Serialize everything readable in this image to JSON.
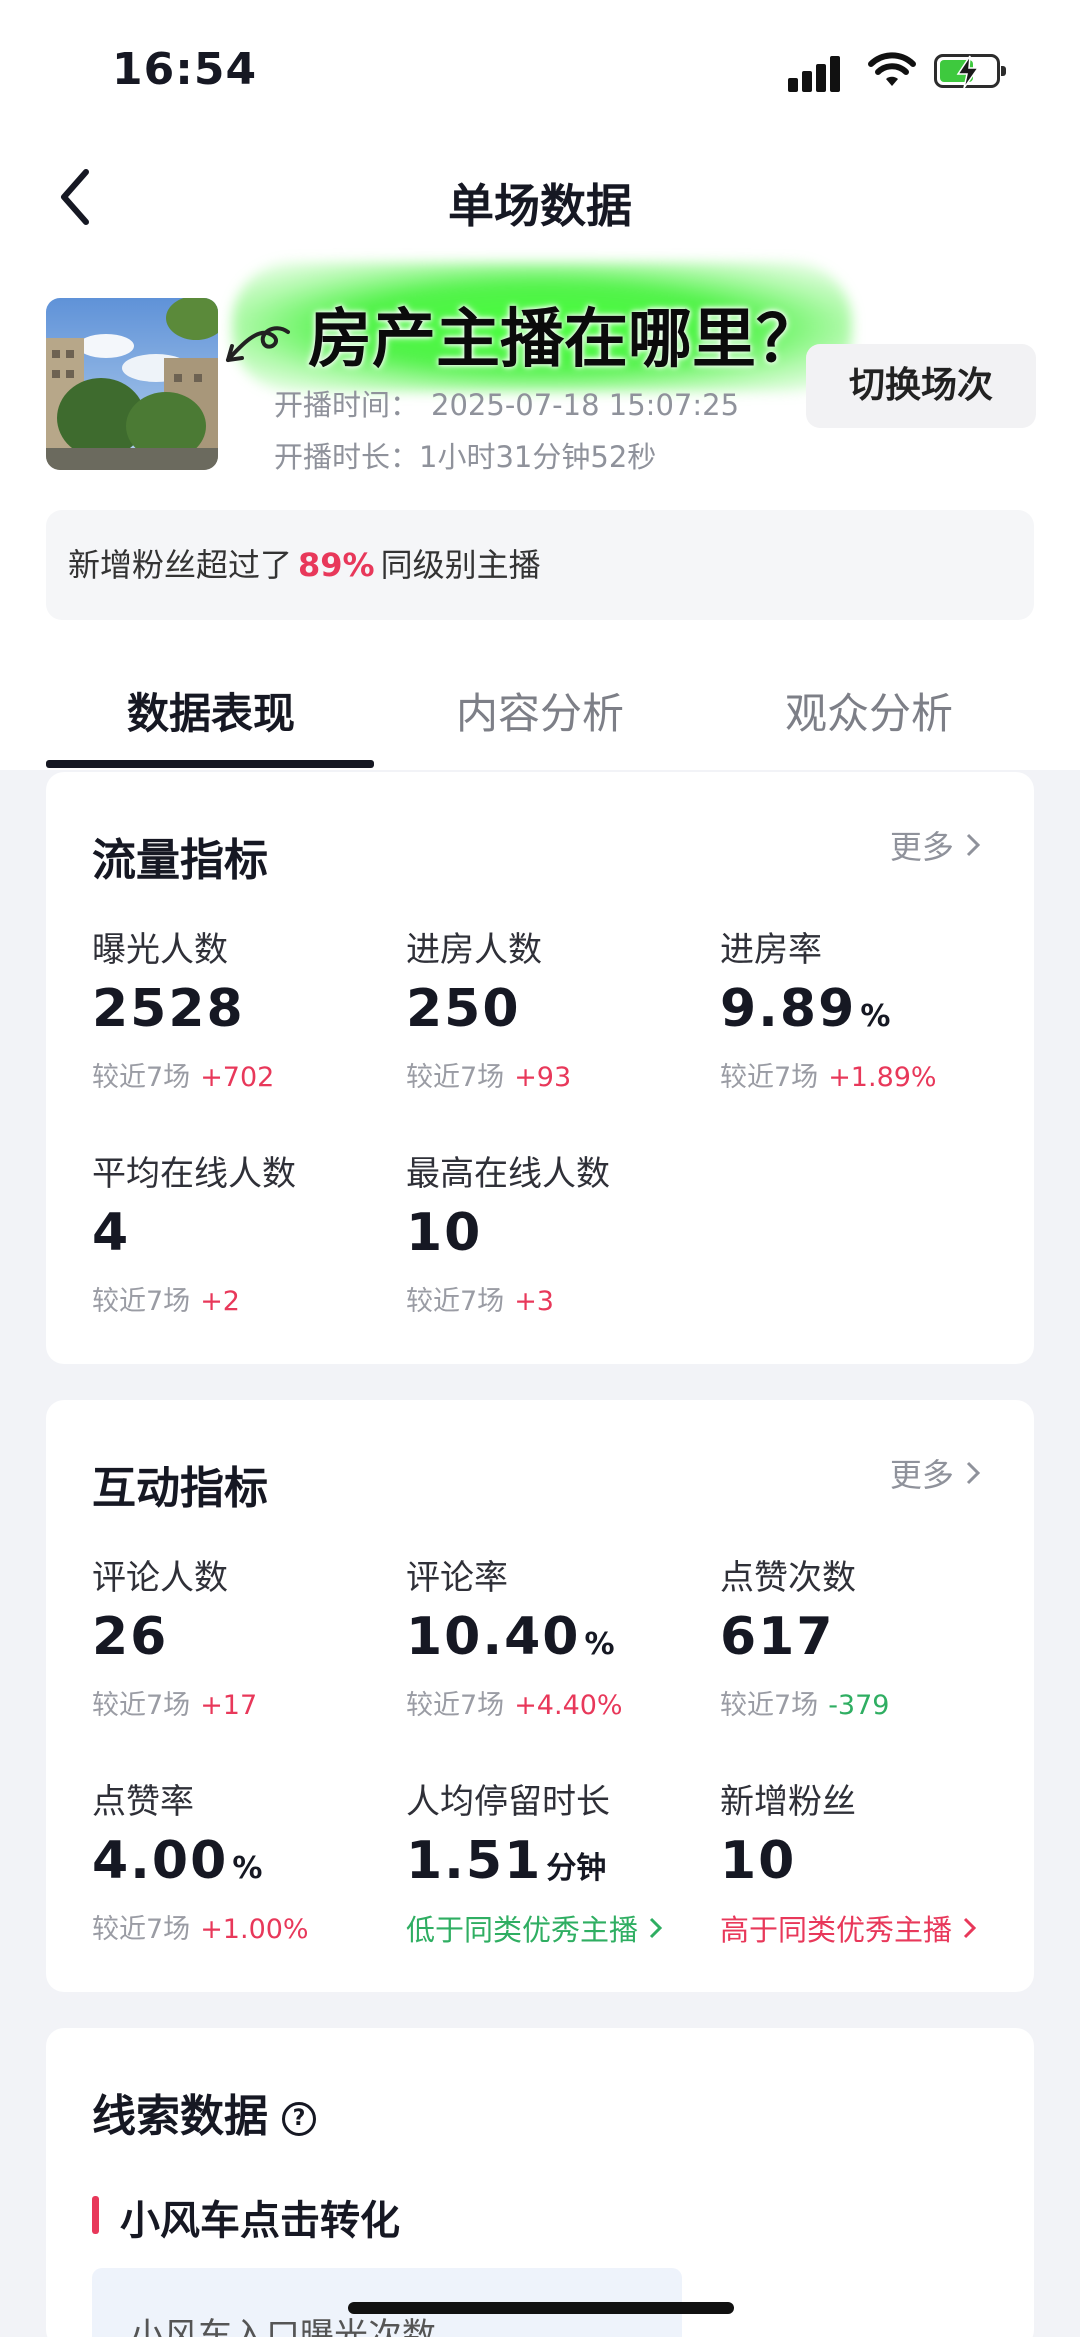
{
  "status_bar": {
    "time": "16:54"
  },
  "nav": {
    "title": "单场数据"
  },
  "promo_overlay": "房产主播在哪里？",
  "session": {
    "start_label": "开播时间：",
    "start_time": "2025-07-18 15:07:25",
    "duration_label": "开播时长：",
    "duration": "1小时31分钟52秒",
    "switch_button": "切换场次"
  },
  "fans_banner": {
    "prefix": "新增粉丝超过了",
    "percent": "89%",
    "suffix": "同级别主播"
  },
  "tabs": [
    {
      "label": "数据表现",
      "active": true
    },
    {
      "label": "内容分析",
      "active": false
    },
    {
      "label": "观众分析",
      "active": false
    }
  ],
  "traffic": {
    "title": "流量指标",
    "more": "更多",
    "metrics": [
      {
        "label": "曝光人数",
        "value": "2528",
        "unit": "",
        "compare": "较近7场",
        "delta": "+702"
      },
      {
        "label": "进房人数",
        "value": "250",
        "unit": "",
        "compare": "较近7场",
        "delta": "+93"
      },
      {
        "label": "进房率",
        "value": "9.89",
        "unit": "%",
        "compare": "较近7场",
        "delta": "+1.89%"
      },
      {
        "label": "平均在线人数",
        "value": "4",
        "unit": "",
        "compare": "较近7场",
        "delta": "+2"
      },
      {
        "label": "最高在线人数",
        "value": "10",
        "unit": "",
        "compare": "较近7场",
        "delta": "+3"
      }
    ]
  },
  "interaction": {
    "title": "互动指标",
    "more": "更多",
    "metrics": [
      {
        "label": "评论人数",
        "value": "26",
        "unit": "",
        "compare": "较近7场",
        "delta": "+17"
      },
      {
        "label": "评论率",
        "value": "10.40",
        "unit": "%",
        "compare": "较近7场",
        "delta": "+4.40%"
      },
      {
        "label": "点赞次数",
        "value": "617",
        "unit": "",
        "compare": "较近7场",
        "delta": "-379"
      },
      {
        "label": "点赞率",
        "value": "4.00",
        "unit": "%",
        "compare": "较近7场",
        "delta": "+1.00%"
      },
      {
        "label": "人均停留时长",
        "value": "1.51",
        "unit": "分钟",
        "hint": "低于同类优秀主播"
      },
      {
        "label": "新增粉丝",
        "value": "10",
        "unit": "",
        "hint": "高于同类优秀主播"
      }
    ]
  },
  "leads": {
    "title": "线索数据",
    "help": "?",
    "section": "小风车点击转化",
    "first_item": "小风车入口曝光次数"
  },
  "colors": {
    "positive": "#e8385a",
    "negative": "#2fae62",
    "promo_glow": "#46ff3a"
  }
}
